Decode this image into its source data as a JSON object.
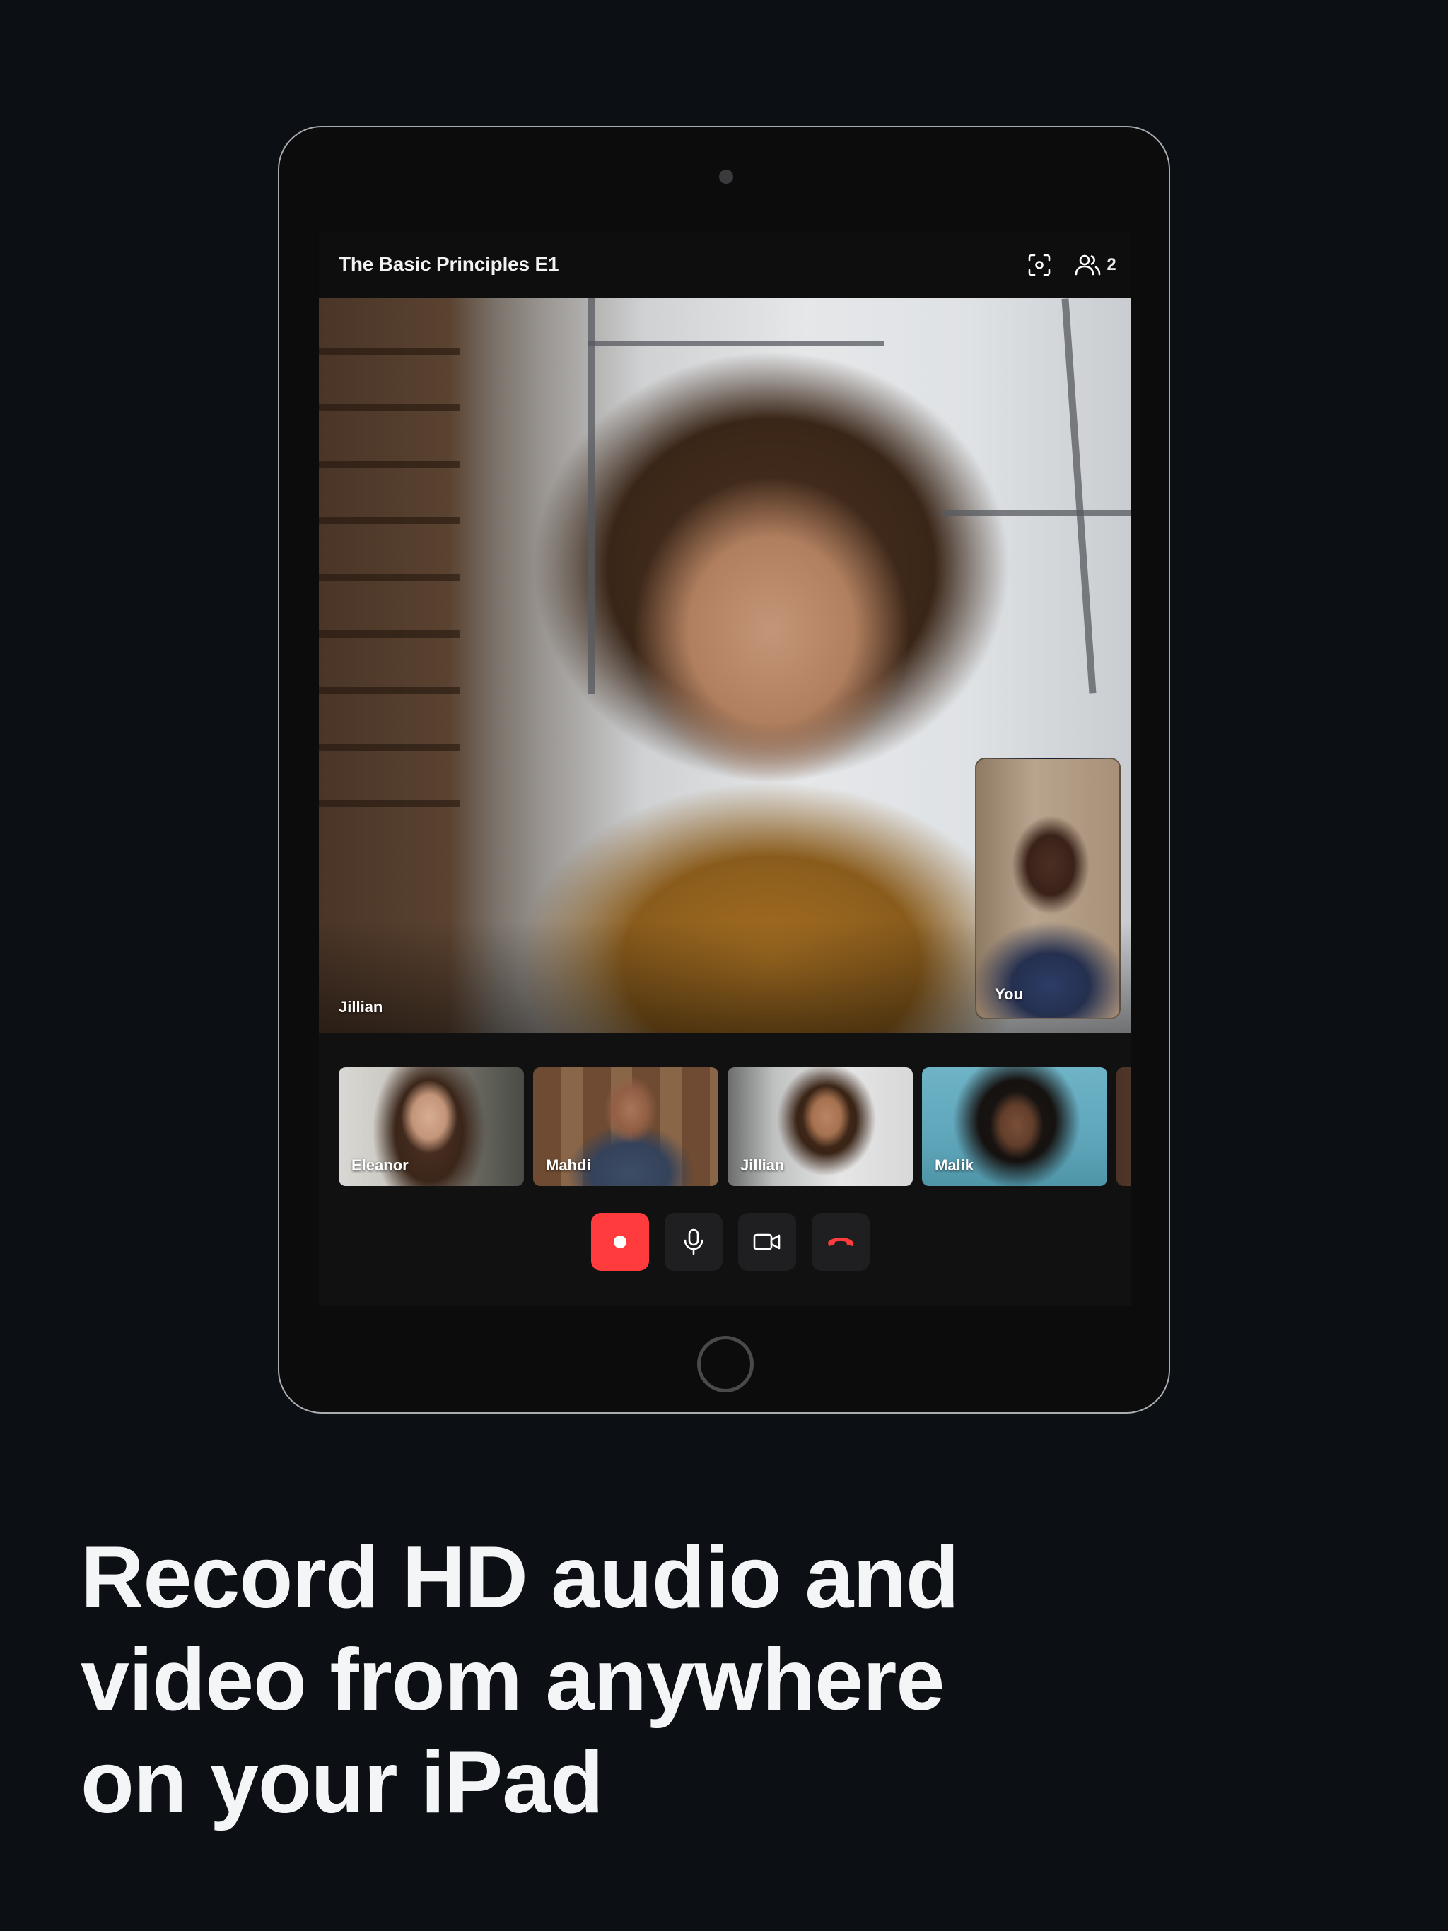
{
  "meeting": {
    "title": "The Basic Principles E1",
    "participant_count": "2"
  },
  "stage": {
    "speaker_name": "Jillian",
    "self_view_label": "You"
  },
  "participants": [
    {
      "name": "Eleanor"
    },
    {
      "name": "Mahdi"
    },
    {
      "name": "Jillian"
    },
    {
      "name": "Malik"
    }
  ],
  "controls": {
    "record": {
      "icon": "record-icon",
      "color": "#ff3b3d"
    },
    "microphone": {
      "icon": "microphone-icon"
    },
    "camera": {
      "icon": "video-camera-icon"
    },
    "end_call": {
      "icon": "phone-hangup-icon",
      "color": "#ff3b3d"
    }
  },
  "toolbar_icons": [
    "screenshot-icon",
    "participants-icon"
  ],
  "headline": {
    "line1": "Record HD audio and",
    "line2": "video from anywhere",
    "line3": "on your iPad"
  },
  "colors": {
    "page_background": "#0c1014",
    "accent_red": "#ff3b3d"
  }
}
